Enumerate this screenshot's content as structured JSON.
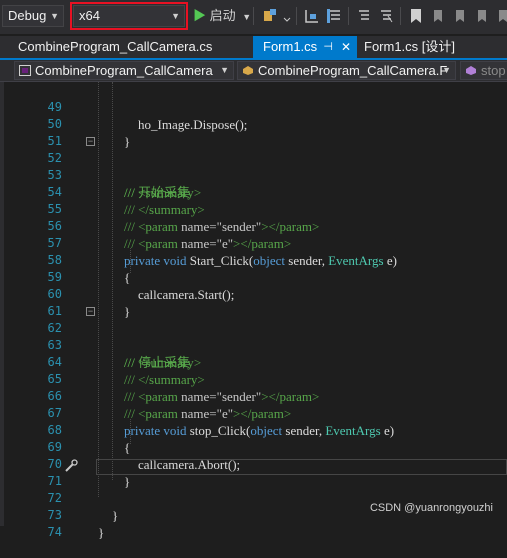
{
  "toolbar": {
    "config": "Debug",
    "platform": "x64",
    "start_label": "启动"
  },
  "tabs": [
    {
      "label": "CombineProgram_CallCamera.cs"
    },
    {
      "label": "Form1.cs",
      "pin": "⊣",
      "close": "✕"
    },
    {
      "label": "Form1.cs [设计]"
    }
  ],
  "navbar": {
    "project": "CombineProgram_CallCamera",
    "type": "CombineProgram_CallCamera.F",
    "member": "stop"
  },
  "editor": {
    "lines": [
      {
        "n": "49",
        "code": "ho_Image.Dispose();"
      },
      {
        "n": "50",
        "code": "}"
      },
      {
        "n": "51",
        "code": ""
      },
      {
        "n": "52",
        "code": "/// <summary>"
      },
      {
        "n": "53",
        "code": "/// 开始采集"
      },
      {
        "n": "54",
        "code": "/// </summary>"
      },
      {
        "n": "55",
        "code": "/// <param name=\"sender\"></param>"
      },
      {
        "n": "56",
        "code": "/// <param name=\"e\"></param>"
      },
      {
        "n": "57",
        "code": "private void Start_Click(object sender, EventArgs e)"
      },
      {
        "n": "58",
        "code": "{"
      },
      {
        "n": "59",
        "code": "callcamera.Start();"
      },
      {
        "n": "60",
        "code": "}"
      },
      {
        "n": "61",
        "code": ""
      },
      {
        "n": "62",
        "code": "/// <summary>"
      },
      {
        "n": "63",
        "code": "/// 停止采集"
      },
      {
        "n": "64",
        "code": "/// </summary>"
      },
      {
        "n": "65",
        "code": "/// <param name=\"sender\"></param>"
      },
      {
        "n": "66",
        "code": "/// <param name=\"e\"></param>"
      },
      {
        "n": "67",
        "code": "private void stop_Click(object sender, EventArgs e)"
      },
      {
        "n": "68",
        "code": "{"
      },
      {
        "n": "69",
        "code": "callcamera.Abort();"
      },
      {
        "n": "70",
        "code": "}"
      },
      {
        "n": "71",
        "code": ""
      },
      {
        "n": "72",
        "code": "}"
      },
      {
        "n": "73",
        "code": "}"
      },
      {
        "n": "74",
        "code": ""
      }
    ]
  },
  "watermark": "CSDN @yuanrongyouzhi",
  "colors": {
    "background": "#1e1e1e",
    "accent": "#007acc",
    "highlight_box": "#e81123",
    "line_number": "#2b91af",
    "keyword": "#569cd6",
    "type": "#4ec9b0",
    "comment": "#57a64a"
  }
}
